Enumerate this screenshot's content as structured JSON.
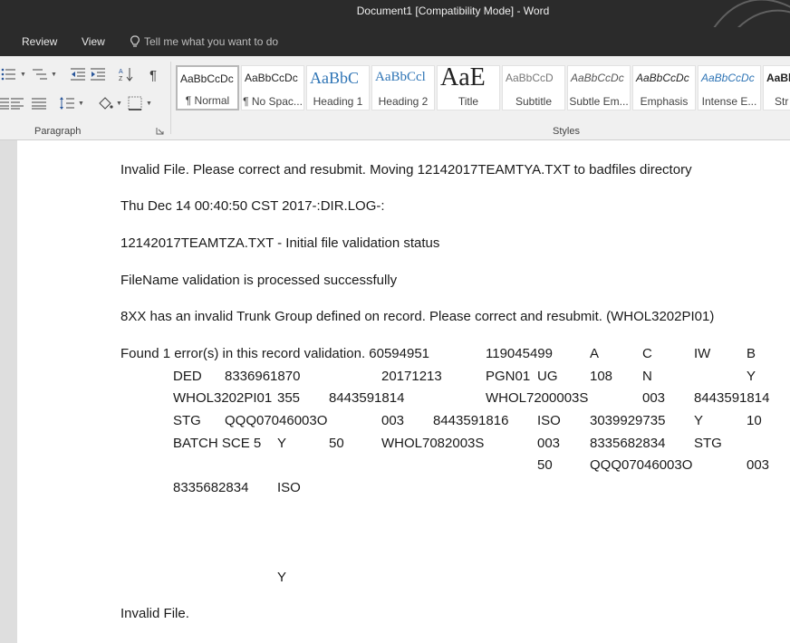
{
  "window": {
    "title": "Document1 [Compatibility Mode]  -  Word"
  },
  "menu": {
    "review": "Review",
    "view": "View",
    "tell_me": "Tell me what you want to do"
  },
  "ribbon": {
    "paragraph_label": "Paragraph",
    "styles_label": "Styles",
    "styles": [
      {
        "sample": "AaBbCcDc",
        "name": "¶ Normal"
      },
      {
        "sample": "AaBbCcDc",
        "name": "¶ No Spac..."
      },
      {
        "sample": "AaBbC",
        "name": "Heading 1"
      },
      {
        "sample": "AaBbCcl",
        "name": "Heading 2"
      },
      {
        "sample": "AaE",
        "name": "Title"
      },
      {
        "sample": "AaBbCcD",
        "name": "Subtitle"
      },
      {
        "sample": "AaBbCcDc",
        "name": "Subtle Em..."
      },
      {
        "sample": "AaBbCcDc",
        "name": "Emphasis"
      },
      {
        "sample": "AaBbCcDc",
        "name": "Intense E..."
      },
      {
        "sample": "AaBl",
        "name": "Str"
      }
    ],
    "colors": {
      "accent": "#2b579a",
      "heading": "#2e74b5"
    }
  },
  "document": {
    "p1": "Invalid File. Please correct and resubmit. Moving 12142017TEAMTYA.TXT to badfiles directory",
    "p2": "Thu Dec 14 00:40:50 CST 2017-:DIR.LOG-:",
    "p3": "12142017TEAMTZA.TXT - Initial file validation status",
    "p4": "FileName validation is processed successfully",
    "p5": "8XX has an invalid Trunk Group defined on record.  Please correct and resubmit. (WHOL3202PI01)",
    "p6": {
      "lead": "Found 1 error(s) in this record validation. 60594951",
      "c1": "119045499",
      "c2": "A",
      "c3": "C",
      "c4": "IW",
      "c5": "B"
    },
    "r1": [
      "DED",
      "8336961870",
      "20171213",
      "PGN01",
      "UG",
      "108",
      "N",
      "Y"
    ],
    "r2": [
      "WHOL3202PI01",
      "355",
      "8443591814",
      "WHOL7200003S",
      "003",
      "8443591814"
    ],
    "r3": [
      "STG",
      "QQQ07046003O",
      "003",
      "8443591816",
      "ISO",
      "3039929735",
      "Y",
      "10"
    ],
    "r4": [
      "BATCH SCE 5",
      "Y",
      "50",
      "WHOL7082003S",
      "003",
      "8335682834",
      "STG"
    ],
    "r5": [
      "50",
      "QQQ07046003O",
      "003"
    ],
    "r6": [
      "8335682834",
      "ISO"
    ],
    "y_alone": "Y",
    "p_last": "Invalid File."
  }
}
